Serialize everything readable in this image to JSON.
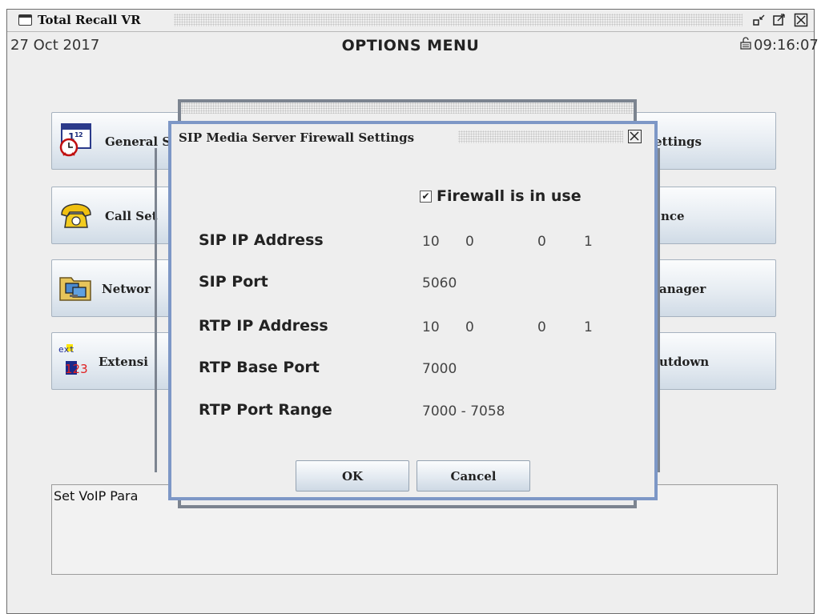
{
  "window": {
    "title": "Total Recall VR",
    "date": "27 Oct 2017",
    "header": "OPTIONS MENU",
    "time": "09:16:07",
    "icons": [
      "app-window-icon",
      "minimize-icon",
      "maximize-icon",
      "close-icon",
      "lock-icon"
    ]
  },
  "menu": {
    "left": [
      {
        "label": "General S",
        "icon": "calendar-clock-icon"
      },
      {
        "label": "Call Set",
        "icon": "telephone-icon"
      },
      {
        "label": "Networ",
        "icon": "network-computer-icon"
      },
      {
        "label": "Extensi",
        "icon": "extension-icon"
      }
    ],
    "right": [
      {
        "label": "ettings"
      },
      {
        "label": "nce"
      },
      {
        "label": "anager"
      },
      {
        "label": "utdown"
      }
    ],
    "ext_icon_text": "ext",
    "ext_icon_num": "123"
  },
  "status": {
    "text": "Set VoIP Para"
  },
  "dialog": {
    "title": "SIP Media Server Firewall Settings",
    "firewall_checked": true,
    "firewall_label": "Firewall is in use",
    "sip_ip_label": "SIP IP Address",
    "sip_ip": [
      "10",
      "0",
      "0",
      "1"
    ],
    "sip_port_label": "SIP Port",
    "sip_port": "5060",
    "rtp_ip_label": "RTP IP Address",
    "rtp_ip": [
      "10",
      "0",
      "0",
      "1"
    ],
    "rtp_base_label": "RTP Base Port",
    "rtp_base": "7000",
    "rtp_range_label": "RTP Port Range",
    "rtp_range": "7000 - 7058",
    "ok_label": "OK",
    "cancel_label": "Cancel"
  }
}
